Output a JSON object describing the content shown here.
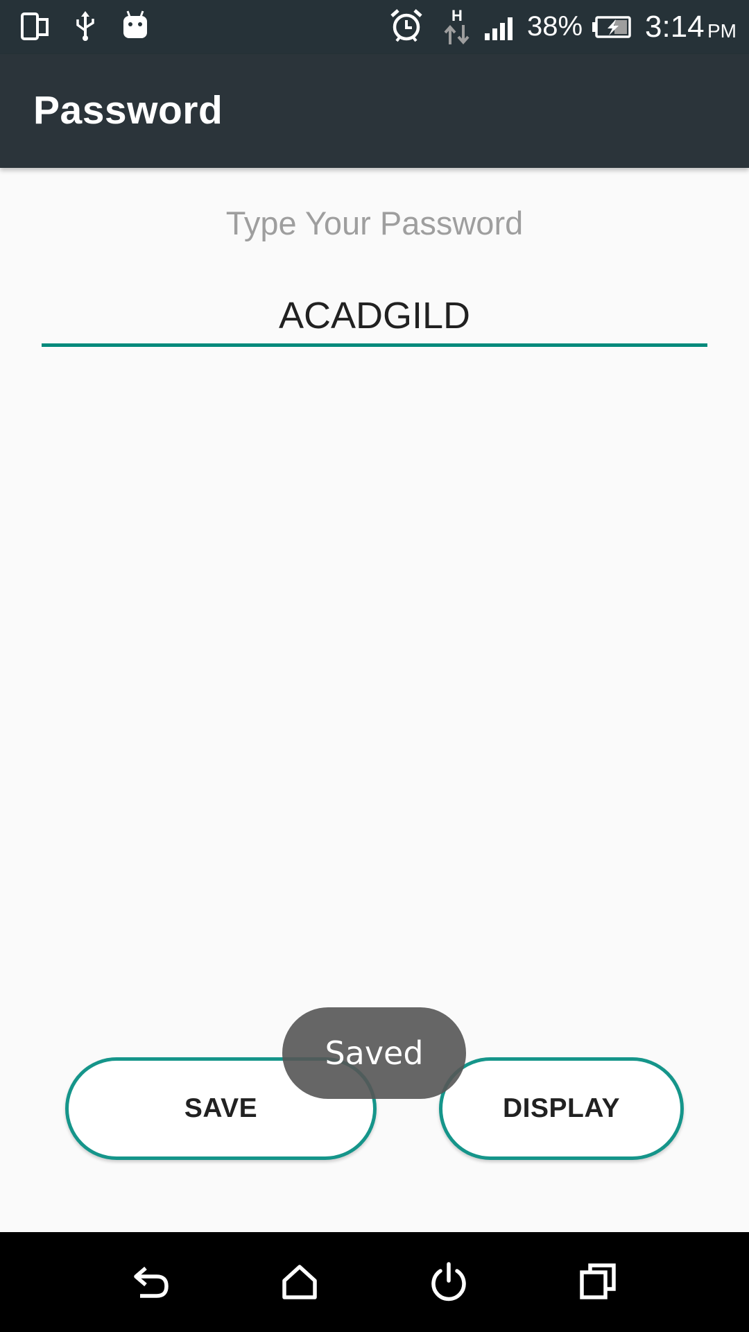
{
  "status_bar": {
    "battery_percent": "38%",
    "network_type": "H",
    "time": "3:14",
    "time_suffix": "PM",
    "icons": [
      "screen-mirror-icon",
      "usb-icon",
      "android-icon",
      "alarm-icon",
      "mobile-data-icon",
      "signal-icon",
      "battery-charging-icon"
    ]
  },
  "app_bar": {
    "title": "Password"
  },
  "form": {
    "hint": "Type Your Password",
    "password_value": "ACADGILD"
  },
  "buttons": {
    "save_label": "SAVE",
    "display_label": "DISPLAY"
  },
  "toast": {
    "message": "Saved"
  },
  "colors": {
    "status_bar": "#263238",
    "app_bar": "#2b343a",
    "accent": "#00897b",
    "button_border": "#15958a",
    "toast": "#555555",
    "nav_bar": "#000000"
  },
  "nav_bar": {
    "icons": [
      "back-icon",
      "home-icon",
      "power-icon",
      "recents-icon"
    ]
  }
}
